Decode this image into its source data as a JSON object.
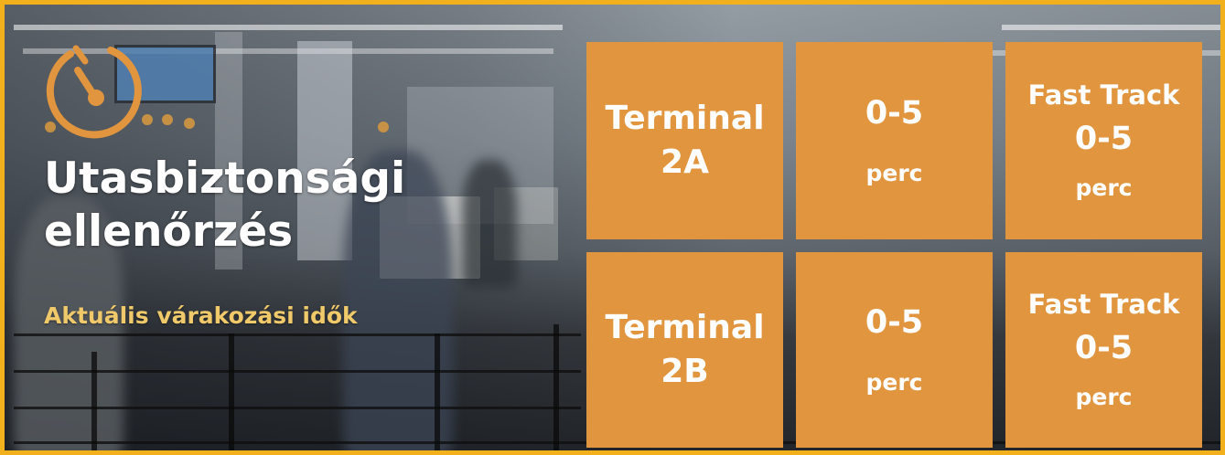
{
  "widget": {
    "title_line1": "Utasbiztonsági",
    "title_line2": "ellenőrzés",
    "subtitle": "Aktuális várakozási idők",
    "icon": "stopwatch-icon",
    "colors": {
      "border": "#f2b01c",
      "tile": "#e0953e",
      "subtitle": "#f0c96a",
      "icon": "#e0953e"
    }
  },
  "rows": [
    {
      "terminal_line1": "Terminal",
      "terminal_line2": "2A",
      "wait_value": "0-5",
      "wait_unit": "perc",
      "fast_track_label": "Fast Track",
      "fast_track_value": "0-5",
      "fast_track_unit": "perc"
    },
    {
      "terminal_line1": "Terminal",
      "terminal_line2": "2B",
      "wait_value": "0-5",
      "wait_unit": "perc",
      "fast_track_label": "Fast Track",
      "fast_track_value": "0-5",
      "fast_track_unit": "perc"
    }
  ]
}
